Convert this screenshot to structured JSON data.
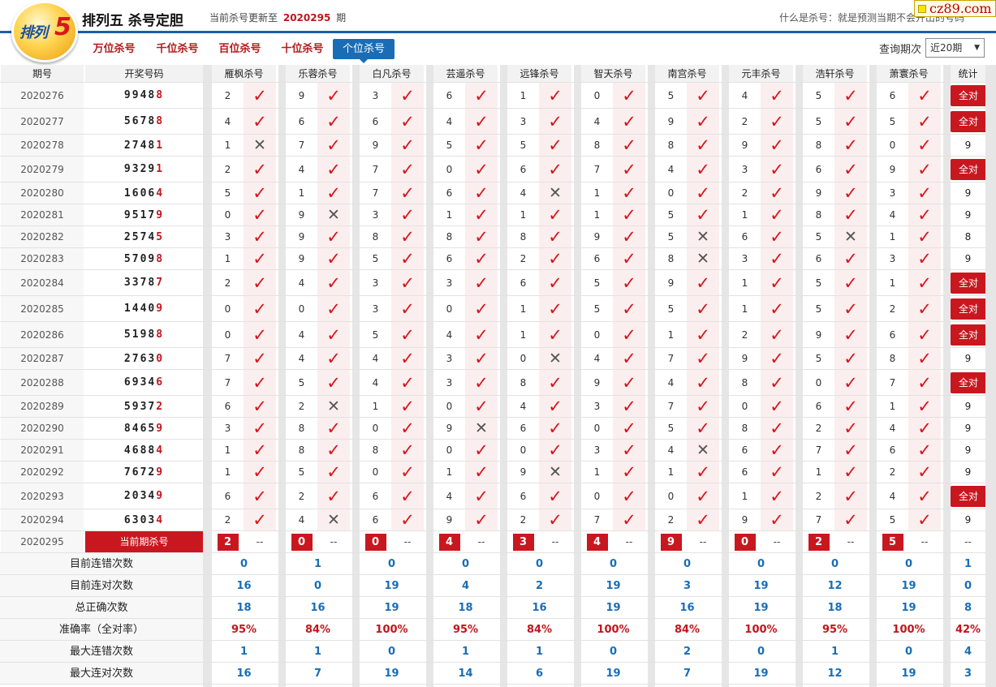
{
  "header": {
    "logo_text": "排列",
    "logo_num": "5",
    "title": "排列五 杀号定胆",
    "update_prefix": "当前杀号更新至",
    "update_issue": "2020295",
    "update_suffix": "期",
    "what_text": "什么是杀号：就是预测当期不会开出的号码",
    "brand": "cz89.com"
  },
  "tabs": [
    {
      "label": "万位杀号",
      "active": false
    },
    {
      "label": "千位杀号",
      "active": false
    },
    {
      "label": "百位杀号",
      "active": false
    },
    {
      "label": "十位杀号",
      "active": false
    },
    {
      "label": "个位杀号",
      "active": true
    }
  ],
  "query": {
    "label": "查询期次",
    "value": "近20期"
  },
  "columns": {
    "period": "期号",
    "draw": "开奖号码",
    "experts": [
      "雁枫杀号",
      "乐蓉杀号",
      "白凡杀号",
      "芸遥杀号",
      "远锋杀号",
      "智天杀号",
      "南宫杀号",
      "元丰杀号",
      "浩轩杀号",
      "萧寰杀号"
    ],
    "stat": "统计"
  },
  "rows": [
    {
      "period": "2020276",
      "head": "9948",
      "last": "8",
      "kills": [
        "2",
        "9",
        "3",
        "6",
        "1",
        "0",
        "5",
        "4",
        "5",
        "6"
      ],
      "ok": [
        1,
        1,
        1,
        1,
        1,
        1,
        1,
        1,
        1,
        1
      ],
      "stat": "全对"
    },
    {
      "period": "2020277",
      "head": "5678",
      "last": "8",
      "kills": [
        "4",
        "6",
        "6",
        "4",
        "3",
        "4",
        "9",
        "2",
        "5",
        "5"
      ],
      "ok": [
        1,
        1,
        1,
        1,
        1,
        1,
        1,
        1,
        1,
        1
      ],
      "stat": "全对"
    },
    {
      "period": "2020278",
      "head": "2748",
      "last": "1",
      "kills": [
        "1",
        "7",
        "9",
        "5",
        "5",
        "8",
        "8",
        "9",
        "8",
        "0"
      ],
      "ok": [
        0,
        1,
        1,
        1,
        1,
        1,
        1,
        1,
        1,
        1
      ],
      "stat": "9"
    },
    {
      "period": "2020279",
      "head": "9329",
      "last": "1",
      "kills": [
        "2",
        "4",
        "7",
        "0",
        "6",
        "7",
        "4",
        "3",
        "6",
        "9"
      ],
      "ok": [
        1,
        1,
        1,
        1,
        1,
        1,
        1,
        1,
        1,
        1
      ],
      "stat": "全对"
    },
    {
      "period": "2020280",
      "head": "1606",
      "last": "4",
      "kills": [
        "5",
        "1",
        "7",
        "6",
        "4",
        "1",
        "0",
        "2",
        "9",
        "3"
      ],
      "ok": [
        1,
        1,
        1,
        1,
        0,
        1,
        1,
        1,
        1,
        1
      ],
      "stat": "9"
    },
    {
      "period": "2020281",
      "head": "9517",
      "last": "9",
      "kills": [
        "0",
        "9",
        "3",
        "1",
        "1",
        "1",
        "5",
        "1",
        "8",
        "4"
      ],
      "ok": [
        1,
        0,
        1,
        1,
        1,
        1,
        1,
        1,
        1,
        1
      ],
      "stat": "9"
    },
    {
      "period": "2020282",
      "head": "2574",
      "last": "5",
      "kills": [
        "3",
        "9",
        "8",
        "8",
        "8",
        "9",
        "5",
        "6",
        "5",
        "1"
      ],
      "ok": [
        1,
        1,
        1,
        1,
        1,
        1,
        0,
        1,
        0,
        1
      ],
      "stat": "8"
    },
    {
      "period": "2020283",
      "head": "5709",
      "last": "8",
      "kills": [
        "1",
        "9",
        "5",
        "6",
        "2",
        "6",
        "8",
        "3",
        "6",
        "3"
      ],
      "ok": [
        1,
        1,
        1,
        1,
        1,
        1,
        0,
        1,
        1,
        1
      ],
      "stat": "9"
    },
    {
      "period": "2020284",
      "head": "3378",
      "last": "7",
      "kills": [
        "2",
        "4",
        "3",
        "3",
        "6",
        "5",
        "9",
        "1",
        "5",
        "1"
      ],
      "ok": [
        1,
        1,
        1,
        1,
        1,
        1,
        1,
        1,
        1,
        1
      ],
      "stat": "全对"
    },
    {
      "period": "2020285",
      "head": "1440",
      "last": "9",
      "kills": [
        "0",
        "0",
        "3",
        "0",
        "1",
        "5",
        "5",
        "1",
        "5",
        "2"
      ],
      "ok": [
        1,
        1,
        1,
        1,
        1,
        1,
        1,
        1,
        1,
        1
      ],
      "stat": "全对"
    },
    {
      "period": "2020286",
      "head": "5198",
      "last": "8",
      "kills": [
        "0",
        "4",
        "5",
        "4",
        "1",
        "0",
        "1",
        "2",
        "9",
        "6"
      ],
      "ok": [
        1,
        1,
        1,
        1,
        1,
        1,
        1,
        1,
        1,
        1
      ],
      "stat": "全对"
    },
    {
      "period": "2020287",
      "head": "2763",
      "last": "0",
      "kills": [
        "7",
        "4",
        "4",
        "3",
        "0",
        "4",
        "7",
        "9",
        "5",
        "8"
      ],
      "ok": [
        1,
        1,
        1,
        1,
        0,
        1,
        1,
        1,
        1,
        1
      ],
      "stat": "9"
    },
    {
      "period": "2020288",
      "head": "6934",
      "last": "6",
      "kills": [
        "7",
        "5",
        "4",
        "3",
        "8",
        "9",
        "4",
        "8",
        "0",
        "7"
      ],
      "ok": [
        1,
        1,
        1,
        1,
        1,
        1,
        1,
        1,
        1,
        1
      ],
      "stat": "全对"
    },
    {
      "period": "2020289",
      "head": "5937",
      "last": "2",
      "kills": [
        "6",
        "2",
        "1",
        "0",
        "4",
        "3",
        "7",
        "0",
        "6",
        "1"
      ],
      "ok": [
        1,
        0,
        1,
        1,
        1,
        1,
        1,
        1,
        1,
        1
      ],
      "stat": "9"
    },
    {
      "period": "2020290",
      "head": "8465",
      "last": "9",
      "kills": [
        "3",
        "8",
        "0",
        "9",
        "6",
        "0",
        "5",
        "8",
        "2",
        "4"
      ],
      "ok": [
        1,
        1,
        1,
        0,
        1,
        1,
        1,
        1,
        1,
        1
      ],
      "stat": "9"
    },
    {
      "period": "2020291",
      "head": "4688",
      "last": "4",
      "kills": [
        "1",
        "8",
        "8",
        "0",
        "0",
        "3",
        "4",
        "6",
        "7",
        "6"
      ],
      "ok": [
        1,
        1,
        1,
        1,
        1,
        1,
        0,
        1,
        1,
        1
      ],
      "stat": "9"
    },
    {
      "period": "2020292",
      "head": "7672",
      "last": "9",
      "kills": [
        "1",
        "5",
        "0",
        "1",
        "9",
        "1",
        "1",
        "6",
        "1",
        "2"
      ],
      "ok": [
        1,
        1,
        1,
        1,
        0,
        1,
        1,
        1,
        1,
        1
      ],
      "stat": "9"
    },
    {
      "period": "2020293",
      "head": "2034",
      "last": "9",
      "kills": [
        "6",
        "2",
        "6",
        "4",
        "6",
        "0",
        "0",
        "1",
        "2",
        "4"
      ],
      "ok": [
        1,
        1,
        1,
        1,
        1,
        1,
        1,
        1,
        1,
        1
      ],
      "stat": "全对"
    },
    {
      "period": "2020294",
      "head": "6303",
      "last": "4",
      "kills": [
        "2",
        "4",
        "6",
        "9",
        "2",
        "7",
        "2",
        "9",
        "7",
        "5"
      ],
      "ok": [
        1,
        0,
        1,
        1,
        1,
        1,
        1,
        1,
        1,
        1
      ],
      "stat": "9"
    }
  ],
  "current": {
    "period": "2020295",
    "label": "当前期杀号",
    "kills": [
      "2",
      "0",
      "0",
      "4",
      "3",
      "4",
      "9",
      "0",
      "2",
      "5"
    ],
    "dash": "--",
    "stat": "--"
  },
  "stats": [
    {
      "label": "目前连错次数",
      "values": [
        "0",
        "1",
        "0",
        "0",
        "0",
        "0",
        "0",
        "0",
        "0",
        "0"
      ],
      "stat": "1",
      "red": false
    },
    {
      "label": "目前连对次数",
      "values": [
        "16",
        "0",
        "19",
        "4",
        "2",
        "19",
        "3",
        "19",
        "12",
        "19"
      ],
      "stat": "0",
      "red": false
    },
    {
      "label": "总正确次数",
      "values": [
        "18",
        "16",
        "19",
        "18",
        "16",
        "19",
        "16",
        "19",
        "18",
        "19"
      ],
      "stat": "8",
      "red": false
    },
    {
      "label": "准确率（全对率）",
      "values": [
        "95%",
        "84%",
        "100%",
        "95%",
        "84%",
        "100%",
        "84%",
        "100%",
        "95%",
        "100%"
      ],
      "stat": "42%",
      "red": true
    },
    {
      "label": "最大连错次数",
      "values": [
        "1",
        "1",
        "0",
        "1",
        "1",
        "0",
        "2",
        "0",
        "1",
        "0"
      ],
      "stat": "4",
      "red": false
    },
    {
      "label": "最大连对次数",
      "values": [
        "16",
        "7",
        "19",
        "14",
        "6",
        "19",
        "7",
        "19",
        "12",
        "19"
      ],
      "stat": "3",
      "red": false
    }
  ],
  "marks": {
    "right": "✓",
    "wrong": "✕"
  }
}
